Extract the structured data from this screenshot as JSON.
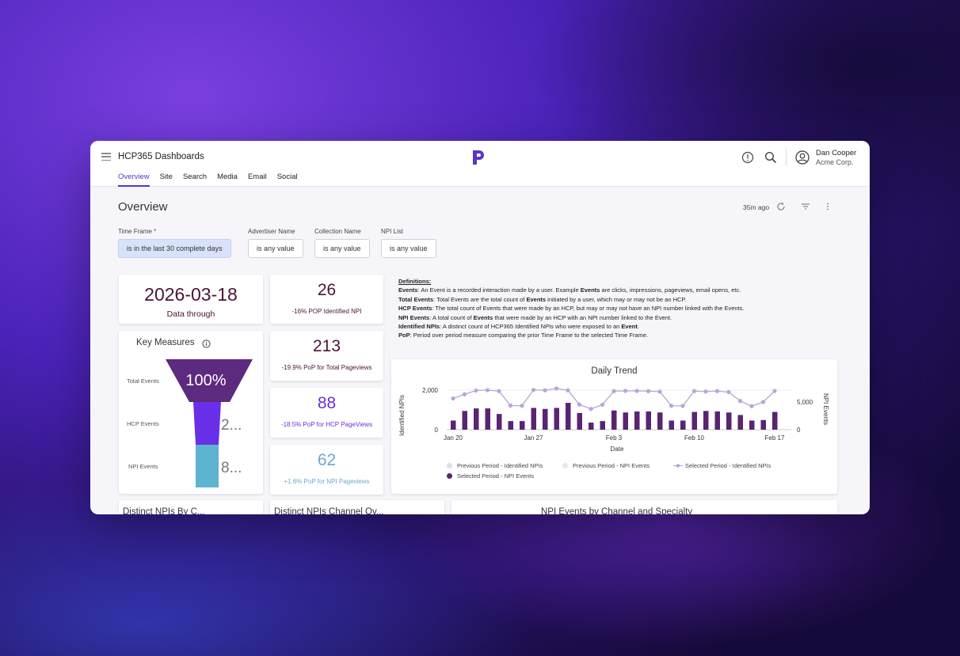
{
  "app": {
    "title": "HCP365 Dashboards"
  },
  "user": {
    "name": "Dan Cooper",
    "org": "Acme Corp."
  },
  "tabs": [
    "Overview",
    "Site",
    "Search",
    "Media",
    "Email",
    "Social"
  ],
  "page": {
    "title": "Overview",
    "updated": "35m ago"
  },
  "filters": [
    {
      "label": "Time Frame",
      "required_mark": "*",
      "value": "is in the last 30 complete days"
    },
    {
      "label": "Advertiser Name",
      "value": "is any value"
    },
    {
      "label": "Collection Name",
      "value": "is any value"
    },
    {
      "label": "NPI List",
      "value": "is any value"
    }
  ],
  "data_through": {
    "value": "2026-03-18",
    "label": "Data through"
  },
  "kpis": [
    {
      "value": "26",
      "sub": "-16% POP Identified NPI",
      "color": "#4a1338"
    },
    {
      "value": "213",
      "sub": "-19.9% PoP for Total Pageviews",
      "color": "#4a1338"
    },
    {
      "value": "88",
      "sub": "-18.5% PoP for HCP PageViews",
      "color": "#6a2fe0"
    },
    {
      "value": "62",
      "sub": "+1.6% PoP for NPI Pageviews",
      "color": "#6aa9cf"
    }
  ],
  "key_measures": {
    "title": "Key Measures",
    "rows": [
      {
        "label": "Total Events",
        "value": "100%",
        "color": "#5c2a7e"
      },
      {
        "label": "HCP Events",
        "value": "2...",
        "color": "#6a2fe8"
      },
      {
        "label": "NPI Events",
        "value": "8...",
        "color": "#5db4cf"
      }
    ]
  },
  "definitions": {
    "title": "Definitions:",
    "items": [
      {
        "term": "Events",
        "text": ": An Event is a recorded interaction made by a user. Example ",
        "term2": "Events",
        "text2": " are clicks, impressions, pageviews, email opens, etc."
      },
      {
        "term": "Total Events",
        "text": ": Total Events are the total count of ",
        "term2": "Events",
        "text2": " initiated by a user, which may or may not be an HCP."
      },
      {
        "term": "HCP Events",
        "text": ": The total count of Events that were made by an HCP, but may or may not have an NPI number linked with the Events.",
        "term2": "",
        "text2": ""
      },
      {
        "term": "NPI Events",
        "text": ": A total count of ",
        "term2": "Events",
        "text2": " that were made by an HCP with an NPI number linked to the Event."
      },
      {
        "term": "Identified NPIs",
        "text": ": A distinct count of HCP365 Identified NPIs who were exposed to an ",
        "term2": "Event",
        "text2": "."
      },
      {
        "term": "PoP",
        "text": ": Period over period measure comparing the prior Time Frame to the selected Time Frame.",
        "term2": "",
        "text2": ""
      }
    ]
  },
  "chart_data": {
    "type": "bar",
    "title": "Daily Trend",
    "xlabel": "Date",
    "ylabel": "Identified NPIs",
    "y2label": "NPI Events",
    "x_ticks": [
      "Jan 20",
      "Jan 27",
      "Feb 3",
      "Feb 10",
      "Feb 17"
    ],
    "y_ticks": [
      "2,000",
      "0"
    ],
    "y2_ticks": [
      "5,000",
      "0"
    ],
    "ylim": [
      0,
      2400
    ],
    "y2lim": [
      0,
      6000
    ],
    "series": [
      {
        "name": "Selected Period - NPI Events",
        "axis": "right",
        "values": [
          1800,
          3700,
          4200,
          4200,
          3100,
          1700,
          1700,
          4300,
          4100,
          4300,
          5300,
          3300,
          1400,
          1700,
          3800,
          3400,
          3600,
          3600,
          3400,
          1800,
          1800,
          3500,
          3700,
          3600,
          3400,
          2900,
          1800,
          1900,
          3500
        ]
      },
      {
        "name": "Selected Period - Identified NPIs",
        "axis": "left",
        "values": [
          1580,
          1790,
          1980,
          2000,
          1950,
          1220,
          1210,
          2010,
          1990,
          2080,
          1990,
          1270,
          1050,
          1260,
          1950,
          1960,
          1960,
          1950,
          1920,
          1210,
          1200,
          1950,
          1930,
          1950,
          1900,
          1450,
          1190,
          1400,
          1960
        ]
      },
      {
        "name": "Previous Period - Identified NPIs",
        "values": []
      },
      {
        "name": "Previous Period - NPI Events",
        "values": []
      }
    ],
    "legend": [
      "Previous Period - Identified NPIs",
      "Previous Period - NPI Events",
      "Selected Period - Identified NPIs",
      "Selected Period - NPI Events"
    ],
    "colors": {
      "bars": "#5a2472",
      "line": "#b9a6d6",
      "prev_npi": "#e0dde8",
      "prev_events": "#e8e8ec"
    }
  },
  "bottom_cards": [
    {
      "title": "Distinct NPIs By C..."
    },
    {
      "title": "Distinct NPIs Channel Ov..."
    },
    {
      "title": "NPI Events by Channel and Specialty"
    }
  ]
}
